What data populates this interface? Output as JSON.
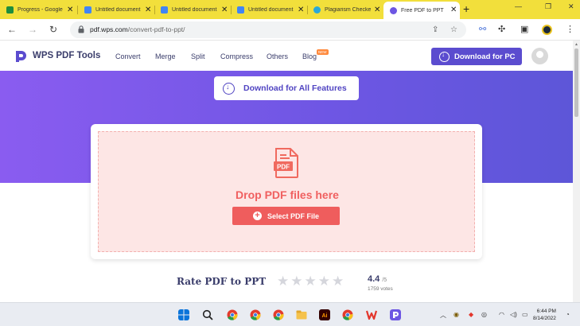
{
  "browser": {
    "tabs": [
      {
        "title": "Progress - Google",
        "favicon_color": "#1e8e3e"
      },
      {
        "title": "Untitled document",
        "favicon_color": "#4285f4"
      },
      {
        "title": "Untitled document",
        "favicon_color": "#4285f4"
      },
      {
        "title": "Untitled document",
        "favicon_color": "#4285f4"
      },
      {
        "title": "Plagiarism Checker",
        "favicon_color": "#2aa8d8"
      },
      {
        "title": "Free PDF to PPT",
        "favicon_color": "#6d56e3",
        "active": true
      }
    ],
    "url_host": "pdf.wps.com",
    "url_path": "/convert-pdf-to-ppt/"
  },
  "site": {
    "brand": "WPS PDF Tools",
    "nav": [
      "Convert",
      "Merge",
      "Split",
      "Compress",
      "Others",
      "Blog"
    ],
    "new_badge": "NEW",
    "download_pc": "Download for PC",
    "download_all": "Download for All Features"
  },
  "dropzone": {
    "icon_label": "PDF",
    "title": "Drop PDF files here",
    "button": "Select PDF File"
  },
  "rating": {
    "title": "Rate PDF to PPT",
    "score": "4.4",
    "out_of": "/5",
    "votes": "1759 votes",
    "star_count": 5
  },
  "taskbar": {
    "time": "6:44 PM",
    "date": "8/14/2022"
  },
  "colors": {
    "accent": "#5b4ccf",
    "hero": "#6d56e3",
    "drop_bg": "#fde6e5",
    "drop_accent": "#ef5d5d",
    "tabstrip": "#f2df3b"
  }
}
